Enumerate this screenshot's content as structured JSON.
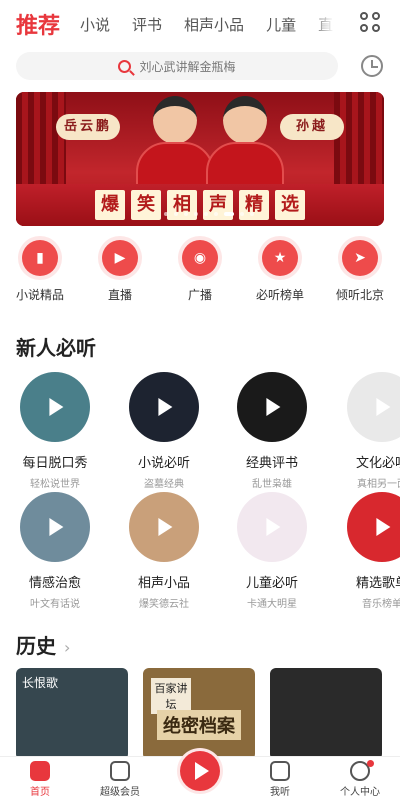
{
  "tabs": {
    "active": "推荐",
    "items": [
      "小说",
      "评书",
      "相声小品",
      "儿童",
      "直播"
    ]
  },
  "search": {
    "placeholder": "刘心武讲解金瓶梅"
  },
  "banner": {
    "left_sign": "岳云鹏",
    "right_sign": "孙越",
    "title_chars": [
      "爆",
      "笑",
      "相",
      "声",
      "精",
      "选"
    ]
  },
  "quick": [
    {
      "label": "小说精品",
      "icon": "book-icon",
      "glyph": "▮"
    },
    {
      "label": "直播",
      "icon": "tv-icon",
      "glyph": "▶"
    },
    {
      "label": "广播",
      "icon": "radio-icon",
      "glyph": "◉"
    },
    {
      "label": "必听榜单",
      "icon": "ranking-medal-icon",
      "glyph": "★"
    },
    {
      "label": "倾听北京",
      "icon": "compass-icon",
      "glyph": "➤"
    }
  ],
  "section_new": {
    "title": "新人必听"
  },
  "new_row1": [
    {
      "name": "每日脱口秀",
      "sub": "轻松说世界",
      "color": "#4a7f8a"
    },
    {
      "name": "小说必听",
      "sub": "盗墓经典",
      "color": "#1d2330"
    },
    {
      "name": "经典评书",
      "sub": "乱世枭雄",
      "color": "#1a1a1a"
    },
    {
      "name": "文化必听",
      "sub": "真相另一面",
      "color": "#e9e9e9"
    }
  ],
  "new_row2": [
    {
      "name": "情感治愈",
      "sub": "叶文有话说",
      "color": "#6f8c9c"
    },
    {
      "name": "相声小品",
      "sub": "爆笑德云社",
      "color": "#c9a07a"
    },
    {
      "name": "儿童必听",
      "sub": "卡通大明星",
      "color": "#f2e8ef"
    },
    {
      "name": "精选歌单",
      "sub": "音乐榜单",
      "color": "#d8282e"
    }
  ],
  "section_history": {
    "title": "历史",
    "chevron": "›"
  },
  "history": [
    {
      "title": "长恨歌",
      "color": "#36474f"
    },
    {
      "title": "百家讲坛",
      "color": "#8a6a3c"
    },
    {
      "title": "绝密档案",
      "color": "#4b3a24"
    },
    {
      "title": "",
      "color": "#2a2a2a"
    }
  ],
  "bottom_nav": [
    {
      "label": "首页",
      "icon": "home-icon",
      "active": true
    },
    {
      "label": "超级会员",
      "icon": "vip-icon",
      "active": false
    },
    {
      "label": "",
      "icon": "play-icon",
      "active": false
    },
    {
      "label": "我听",
      "icon": "my-listen-icon",
      "active": false
    },
    {
      "label": "个人中心",
      "icon": "profile-icon",
      "active": false
    }
  ]
}
